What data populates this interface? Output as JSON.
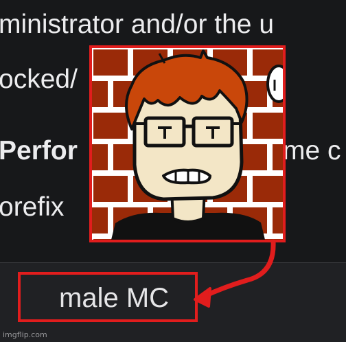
{
  "background_text": {
    "line1": "ministrator and/or the u",
    "line2": "ocked/",
    "line3_bold": "Perfor",
    "line3_rest": "me c",
    "line4": "orefix"
  },
  "profile": {
    "display_name": "male MC",
    "avatar_icon": "cartoon-avatar-icon"
  },
  "watermark": "imgflip.com",
  "colors": {
    "highlight": "#e11d1d",
    "background": "#17181a",
    "brick": "#9a2a08",
    "hair": "#c9470a"
  }
}
